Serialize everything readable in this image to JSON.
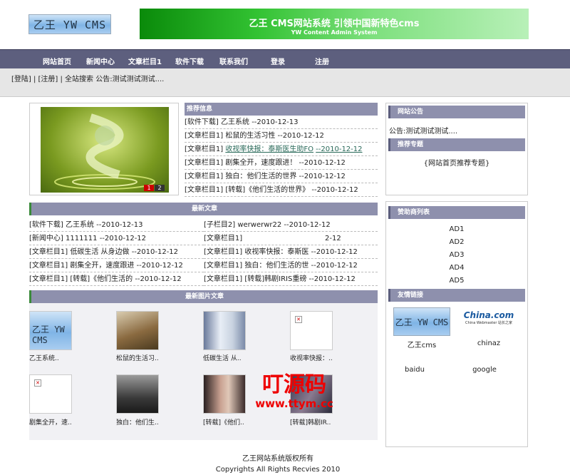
{
  "header": {
    "logo_text": "乙王 YW CMS",
    "banner_title": "乙王 CMS网站系统 引领中国新特色cms",
    "banner_subtitle": "YW Content Admin System"
  },
  "nav": [
    "网站首页",
    "新闻中心",
    "文章栏目1",
    "软件下载",
    "联系我们",
    "登录",
    "注册"
  ],
  "subbar": {
    "text": "[登陆] | [注册] | 全站搜索  公告:测试测试测试...."
  },
  "slideshow": {
    "pager": [
      "1",
      "2"
    ]
  },
  "recommend": {
    "title": "推荐信息",
    "items": [
      {
        "cat": "[软件下载]",
        "title": "乙王系统",
        "date": "--2010-12-13",
        "link": false
      },
      {
        "cat": "[文章栏目1]",
        "title": "松鼠的生活习性",
        "date": "--2010-12-12",
        "link": false
      },
      {
        "cat": "[文章栏目1]",
        "title": "收视率快报：泰斯医生助FO",
        "date": "--2010-12-12",
        "link": true
      },
      {
        "cat": "[文章栏目1]",
        "title": "剧集全开，速度跟进！",
        "date": "--2010-12-12",
        "link": false
      },
      {
        "cat": "[文章栏目1]",
        "title": "独白：他们生活的世界",
        "date": "--2010-12-12",
        "link": false
      },
      {
        "cat": "[文章栏目1]",
        "title": "[转载]《他们生活的世界》",
        "date": "--2010-12-12",
        "link": false
      }
    ]
  },
  "latest": {
    "title": "最新文章",
    "left": [
      "[软件下载] 乙王系统 --2010-12-13",
      "[新闻中心] 1111111 --2010-12-12",
      "[文章栏目1] 低碳生活 从身边做 --2010-12-12",
      "[文章栏目1] 剧集全开，速度跟进 --2010-12-12",
      "[文章栏目1] [转载]《他们生活的 --2010-12-12"
    ],
    "right": [
      "[子栏目2] werwerwr22 --2010-12-12",
      "[文章栏目1]",
      "[文章栏目1] 收视率快报：泰斯医 --2010-12-12",
      "[文章栏目1] 独白：他们生活的世 --2010-12-12",
      "[文章栏目1] [转载]韩剧IRIS重磅 --2010-12-12"
    ],
    "right_extra": "2-12"
  },
  "photos": {
    "title": "最新图片文章",
    "items": [
      "乙王系统..",
      "松鼠的生活习..",
      "低碳生活 从..",
      "收视率快报：..",
      "剧集全开，速..",
      "独白：他们生..",
      "[转载]《他们..",
      "[转载]韩剧IR.."
    ]
  },
  "sidebar": {
    "notice_title": "网站公告",
    "notice_text": "公告:测试测试测试....",
    "topic_title": "推荐专题",
    "topic_text": "{网站首页推荐专题}",
    "sponsor_title": "赞助商列表",
    "sponsors": [
      "AD1",
      "AD2",
      "AD3",
      "AD4",
      "AD5"
    ],
    "links_title": "友情链接",
    "links": [
      "乙王cms",
      "chinaz",
      "baidu",
      "google"
    ],
    "chinaz_logo": "China.com",
    "chinaz_sub": "China Webmaster 站长之家"
  },
  "watermark": {
    "cn": "叮源码",
    "url": "www.ttym.cc"
  },
  "footer": {
    "line1": "乙王网站系统版权所有",
    "line2": "Copyrights All Rights Recvies 2010"
  }
}
